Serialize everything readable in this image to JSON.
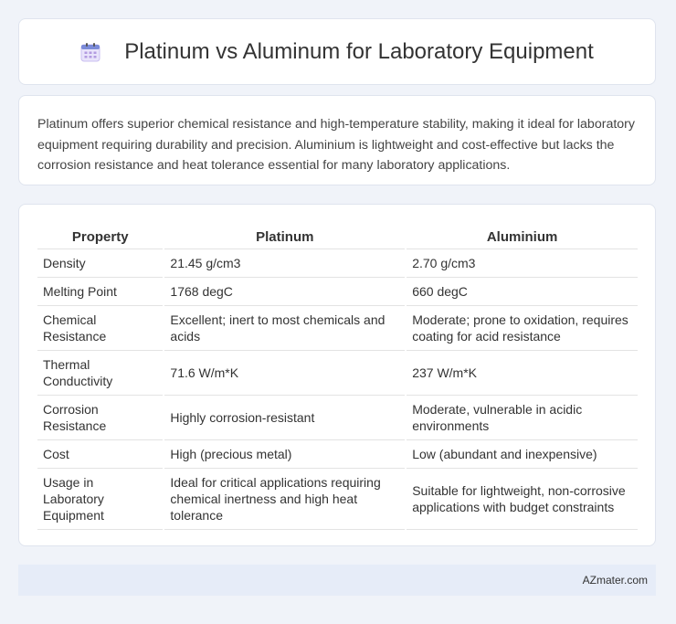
{
  "header": {
    "title": "Platinum vs Aluminum for Laboratory Equipment",
    "icon": "calendar-icon"
  },
  "summary": {
    "text": "Platinum offers superior chemical resistance and high-temperature stability, making it ideal for laboratory equipment requiring durability and precision. Aluminium is lightweight and cost-effective but lacks the corrosion resistance and heat tolerance essential for many laboratory applications."
  },
  "table": {
    "headers": [
      "Property",
      "Platinum",
      "Aluminium"
    ],
    "rows": [
      [
        "Density",
        "21.45 g/cm3",
        "2.70 g/cm3"
      ],
      [
        "Melting Point",
        "1768 degC",
        "660 degC"
      ],
      [
        "Chemical Resistance",
        "Excellent; inert to most chemicals and acids",
        "Moderate; prone to oxidation, requires coating for acid resistance"
      ],
      [
        "Thermal Conductivity",
        "71.6 W/m*K",
        "237 W/m*K"
      ],
      [
        "Corrosion Resistance",
        "Highly corrosion-resistant",
        "Moderate, vulnerable in acidic environments"
      ],
      [
        "Cost",
        "High (precious metal)",
        "Low (abundant and inexpensive)"
      ],
      [
        "Usage in Laboratory Equipment",
        "Ideal for critical applications requiring chemical inertness and high heat tolerance",
        "Suitable for lightweight, non-corrosive applications with budget constraints"
      ]
    ]
  },
  "footer": {
    "text": "AZmater.com"
  }
}
